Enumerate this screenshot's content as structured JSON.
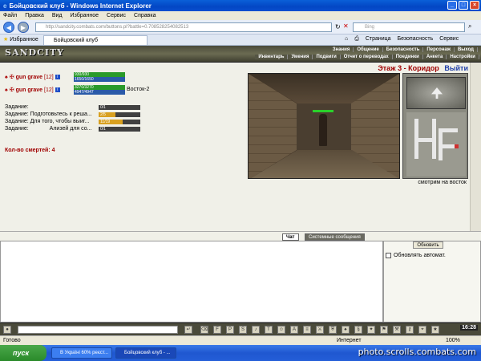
{
  "window": {
    "title": "Бойцовский клуб - Windows Internet Explorer"
  },
  "menu": [
    "Файл",
    "Правка",
    "Вид",
    "Избранное",
    "Сервис",
    "Справка"
  ],
  "address": {
    "url": "http://sandcity.combats.com/buttons.pl?battle=0.708528254082513",
    "search_placeholder": "Bing"
  },
  "tabs": {
    "favorites": "Избранное",
    "active_tab": "Бойцовский клуб"
  },
  "tools": [
    "Страница",
    "Безопасность",
    "Сервис"
  ],
  "game": {
    "logo": "SANDCITY",
    "menu_top": [
      "Знания",
      "Общение",
      "Безопасность",
      "Персонаж",
      "Выход"
    ],
    "menu_bottom": [
      "Инвентарь",
      "Умения",
      "Подвиги",
      "Отчет о переводах",
      "Поединки",
      "Анкета",
      "Настройки"
    ]
  },
  "players": [
    {
      "name": "gun grave",
      "level": "[12]",
      "hp": "930/930",
      "mp": "1650/1650",
      "location": ""
    },
    {
      "name": "gun grave",
      "level": "[12]",
      "hp": "3270/3270",
      "mp": "4947/4947",
      "location": "Восток-2"
    }
  ],
  "tasks": [
    {
      "label": "Задание:",
      "text": "",
      "progress_text": "0/1",
      "progress": 0
    },
    {
      "label": "Задание:",
      "text": "Подготовьтесь к реша...",
      "progress_text": "2/5",
      "progress": 0.4
    },
    {
      "label": "Задание:",
      "text": "Для того, чтобы выиг...",
      "progress_text": "11/19",
      "progress": 0.58
    },
    {
      "label": "Задание:",
      "text": "Ализей для со...",
      "progress_text": "0/1",
      "progress": 0,
      "bold_part": "Ализей"
    }
  ],
  "deaths": "Кол-во смертей: 4",
  "location": {
    "title": "Этаж 3 - Коридор",
    "exit": "Выйти",
    "looking": "смотрим на восток"
  },
  "chat": {
    "tab_chat": "Чат",
    "tab_system": "Системные сообщения",
    "refresh": "Обновить",
    "auto_refresh": "Обновлять автомат.",
    "clock": "16:28"
  },
  "status": {
    "left": "Готово",
    "zone": "Интернет",
    "zoom": "100%"
  },
  "taskbar": {
    "start": "пуск",
    "items": [
      "В Україні 60% реєст...",
      "Бойцовский клуб - ..."
    ],
    "watermark": "photo.scrolls.combats.com"
  },
  "colors": {
    "accent_red": "#a00000",
    "hp_green": "#2a9a2a",
    "mp_blue": "#2a5aa8",
    "task_fill": "#d8a020"
  }
}
